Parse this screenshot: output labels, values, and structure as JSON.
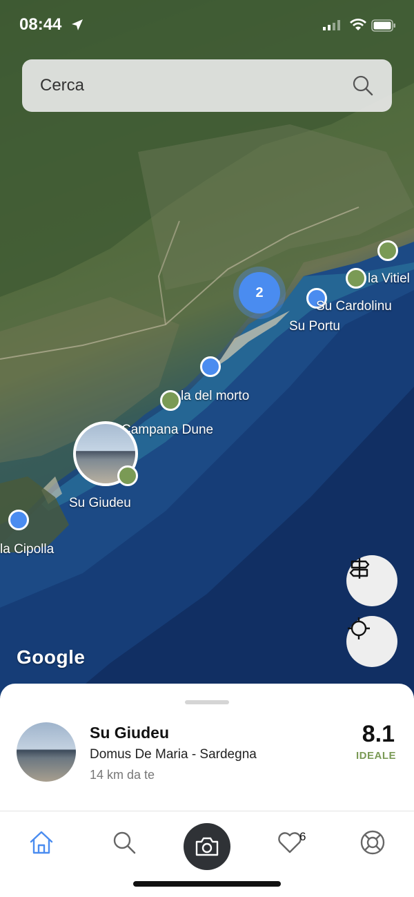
{
  "status_bar": {
    "time": "08:44"
  },
  "search": {
    "placeholder": "Cerca"
  },
  "map": {
    "cluster_count": "2",
    "labels": {
      "vitiel": "la Vitiel",
      "cardolinu": "Su Cardolinu",
      "portu": "Su Portu",
      "morto": "la del morto",
      "campana": "Campana Dune",
      "giudeu": "Su Giudeu",
      "cipolla": "la Cipolla"
    },
    "attribution": "Google"
  },
  "sheet": {
    "name": "Su Giudeu",
    "location": "Domus De Maria - Sardegna",
    "distance": "14 km da te",
    "score": "8.1",
    "score_label": "IDEALE",
    "score_color": "#7a9a55"
  },
  "tabs": {
    "favorites_count": "6"
  },
  "colors": {
    "blue_pin": "#4a8cf0",
    "green_pin": "#7a9a55",
    "active_tab": "#4a8cf0"
  }
}
